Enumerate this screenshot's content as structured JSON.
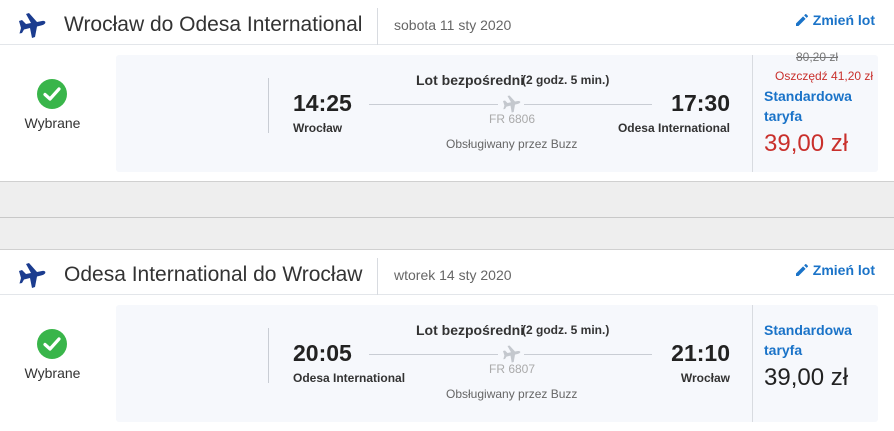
{
  "colors": {
    "accent": "#1a73c8",
    "success": "#39b54a",
    "sale": "#c9302c",
    "plane_icon": "#1b3c8f",
    "card_bg": "#f6f8fc"
  },
  "icons": {
    "header": "airplane-icon",
    "status": "checkmark-circle-icon",
    "edit": "pencil-icon",
    "route": "airplane-small-icon"
  },
  "outbound": {
    "route": "Wrocław do Odesa International",
    "date": "sobota 11 sty 2020",
    "change_label": "Zmień lot",
    "selected_label": "Wybrane",
    "flight_type": "Lot bezpośredni",
    "duration": "(2 godz. 5 min.)",
    "dep_time": "14:25",
    "arr_time": "17:30",
    "dep_city": "Wrocław",
    "arr_city": "Odesa International",
    "flight_no": "FR 6806",
    "operator": "Obsługiwany przez Buzz",
    "old_price": "80,20 zł",
    "savings": "Oszczędź 41,20 zł",
    "fare": "Standardowa taryfa",
    "price": "39,00 zł"
  },
  "return": {
    "route": "Odesa International do Wrocław",
    "date": "wtorek 14 sty 2020",
    "change_label": "Zmień lot",
    "selected_label": "Wybrane",
    "flight_type": "Lot bezpośredni",
    "duration": "(2 godz. 5 min.)",
    "dep_time": "20:05",
    "arr_time": "21:10",
    "dep_city": "Odesa International",
    "arr_city": "Wrocław",
    "flight_no": "FR 6807",
    "operator": "Obsługiwany przez Buzz",
    "fare": "Standardowa taryfa",
    "price": "39,00 zł"
  }
}
